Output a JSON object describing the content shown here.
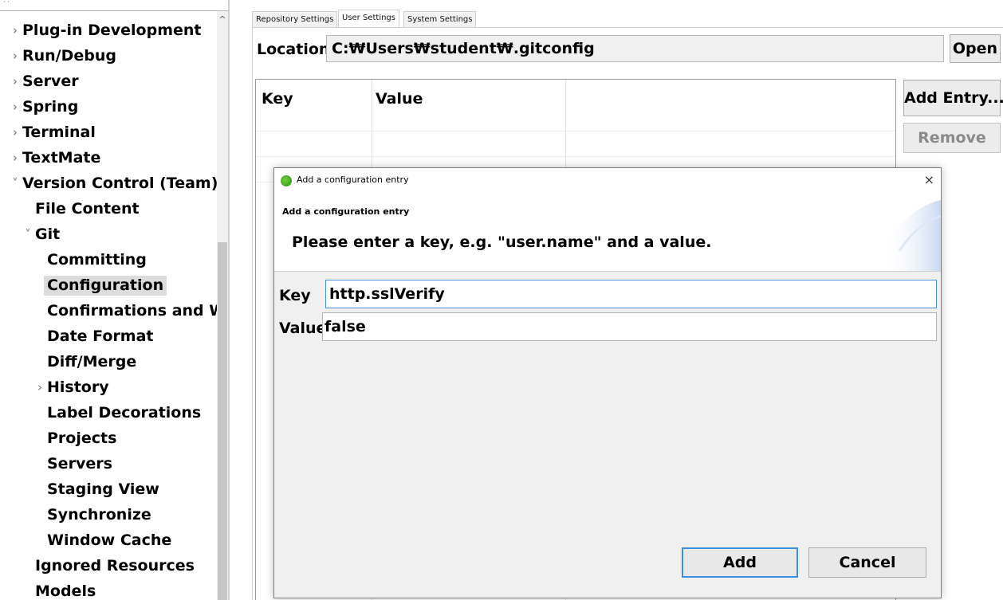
{
  "tree": {
    "items": [
      {
        "label": "Plug-in Development",
        "arrow": "›"
      },
      {
        "label": "Run/Debug",
        "arrow": "›"
      },
      {
        "label": "Server",
        "arrow": "›"
      },
      {
        "label": "Spring",
        "arrow": "›"
      },
      {
        "label": "Terminal",
        "arrow": "›"
      },
      {
        "label": "TextMate",
        "arrow": "›"
      },
      {
        "label": "Version Control (Team)",
        "arrow": "˅"
      },
      {
        "label": "File Content",
        "arrow": ""
      },
      {
        "label": "Git",
        "arrow": "˅"
      },
      {
        "label": "Committing",
        "arrow": ""
      },
      {
        "label": "Configuration",
        "arrow": "",
        "selected": true
      },
      {
        "label": "Confirmations and Warnings",
        "arrow": ""
      },
      {
        "label": "Date Format",
        "arrow": ""
      },
      {
        "label": "Diff/Merge",
        "arrow": ""
      },
      {
        "label": "History",
        "arrow": "›"
      },
      {
        "label": "Label Decorations",
        "arrow": ""
      },
      {
        "label": "Projects",
        "arrow": ""
      },
      {
        "label": "Servers",
        "arrow": ""
      },
      {
        "label": "Staging View",
        "arrow": ""
      },
      {
        "label": "Synchronize",
        "arrow": ""
      },
      {
        "label": "Window Cache",
        "arrow": ""
      },
      {
        "label": "Ignored Resources",
        "arrow": ""
      },
      {
        "label": "Models",
        "arrow": ""
      }
    ],
    "scroll_up_glyph": "^"
  },
  "tabs": [
    {
      "label": "Repository Settings"
    },
    {
      "label": "User Settings",
      "active": true
    },
    {
      "label": "System Settings"
    }
  ],
  "location": {
    "label": "Location:",
    "value": "C:₩Users₩student₩.gitconfig",
    "open_label": "Open"
  },
  "table": {
    "columns": [
      "Key",
      "Value"
    ],
    "rows": []
  },
  "actions": {
    "add_entry_label": "Add Entry...",
    "remove_label": "Remove"
  },
  "dialog": {
    "window_title": "Add a configuration entry",
    "close_glyph": "×",
    "header_title": "Add a configuration entry",
    "header_message": "Please enter a key, e.g. \"user.name\" and a value.",
    "key_label": "Key",
    "key_value": "http.sslVerify",
    "value_label": "Value",
    "value_value": "false",
    "add_label": "Add",
    "cancel_label": "Cancel"
  },
  "colors": {
    "selection": "#dcdcdc",
    "default_button_border": "#3c8ee0",
    "focused_input_border": "#4a90d9",
    "app_icon": "#3fa31f"
  }
}
